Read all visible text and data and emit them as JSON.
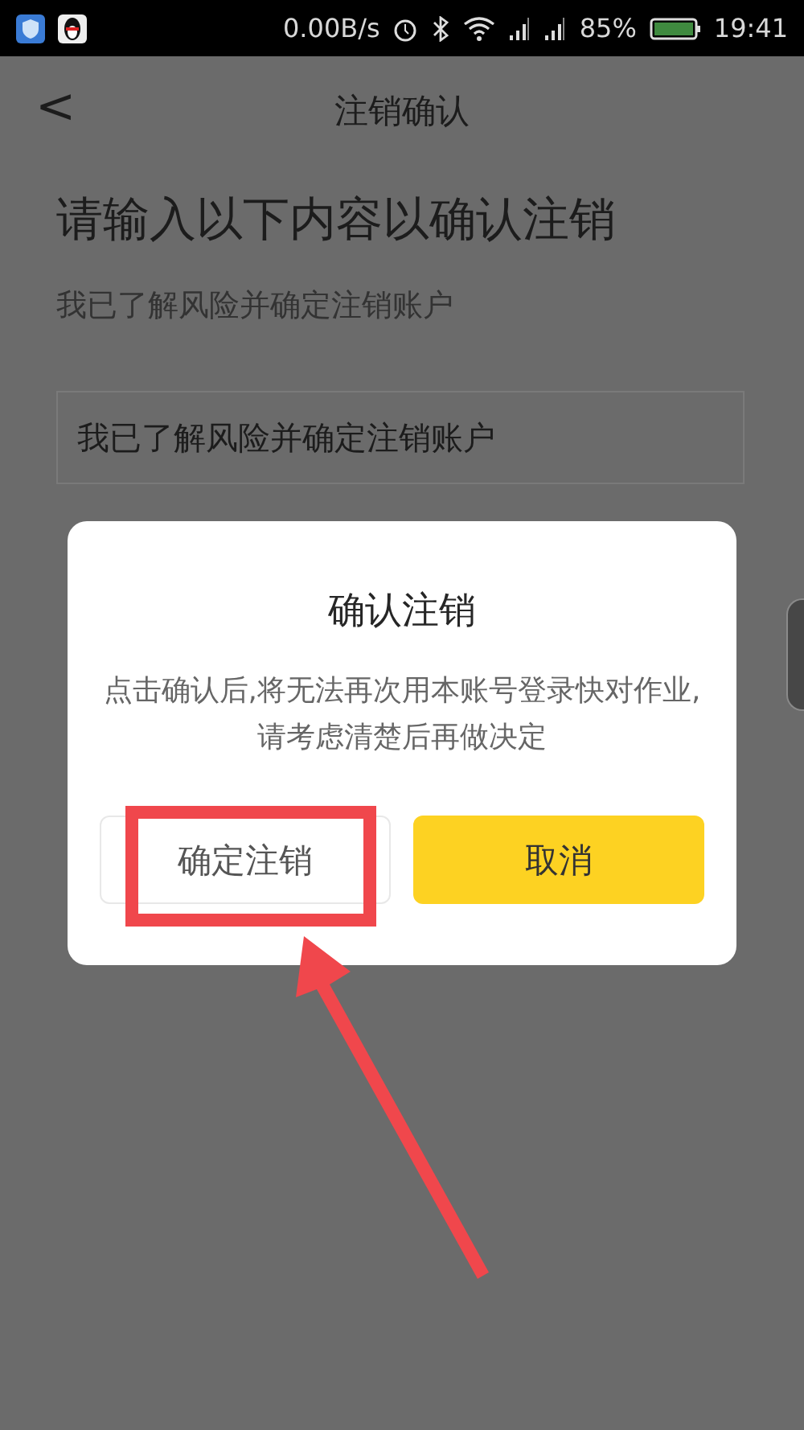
{
  "status_bar": {
    "speed": "0.00B/s",
    "battery": "85%",
    "time": "19:41"
  },
  "nav": {
    "back": "<",
    "title": "注销确认"
  },
  "heading": "请输入以下内容以确认注销",
  "hint": "我已了解风险并确定注销账户",
  "input": {
    "value": "我已了解风险并确定注销账户"
  },
  "dialog": {
    "title": "确认注销",
    "message": "点击确认后,将无法再次用本账号登录快对作业,请考虑清楚后再做决定",
    "buttons": [
      {
        "label": "确定注销",
        "kind": "outline"
      },
      {
        "label": "取消",
        "kind": "primary"
      }
    ]
  }
}
